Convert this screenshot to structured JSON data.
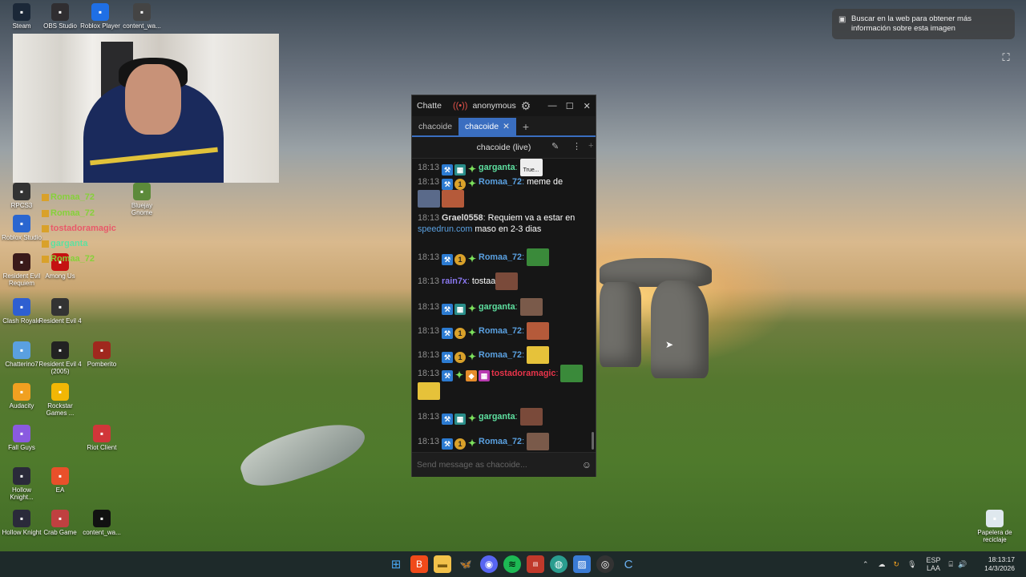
{
  "desktop_icons": [
    {
      "label": "Steam",
      "icon": "steam-icon",
      "color": "#1b2838"
    },
    {
      "label": "OBS Studio",
      "icon": "obs-icon",
      "color": "#302e31"
    },
    {
      "label": "Roblox Player",
      "icon": "roblox-icon",
      "color": "#1f6fe5"
    },
    {
      "label": "content_wa...",
      "icon": "file-icon",
      "color": "#444444"
    },
    {
      "label": "Clash Royale",
      "icon": "clash-royale-icon",
      "color": "#2e5fd1"
    },
    {
      "label": "Resident Evil 4",
      "icon": "resident-evil-icon",
      "color": "#333333"
    },
    {
      "label": "Chatterino7",
      "icon": "chatterino-icon",
      "color": "#5aa0e0"
    },
    {
      "label": "Resident Evil 4 (2005)",
      "icon": "resident-evil-2005-icon",
      "color": "#222222"
    },
    {
      "label": "Pomberito",
      "icon": "pomberito-icon",
      "color": "#a0281e"
    },
    {
      "label": "Audacity",
      "icon": "audacity-icon",
      "color": "#f0a020"
    },
    {
      "label": "Rockstar Games ...",
      "icon": "rockstar-icon",
      "color": "#f2b705"
    },
    {
      "label": "Fall Guys",
      "icon": "fall-guys-icon",
      "color": "#8a5ae0"
    },
    {
      "label": "Riot Client",
      "icon": "riot-icon",
      "color": "#d13639"
    },
    {
      "label": "Hollow Knight...",
      "icon": "hollow-knight-icon",
      "color": "#2a2a3a"
    },
    {
      "label": "EA",
      "icon": "ea-icon",
      "color": "#e8502a"
    },
    {
      "label": "Hollow Knight",
      "icon": "hollow-knight-icon",
      "color": "#2a2a3a"
    },
    {
      "label": "Crab Game",
      "icon": "crab-game-icon",
      "color": "#c04040"
    },
    {
      "label": "content_wa...",
      "icon": "file-icon",
      "color": "#111111"
    },
    {
      "label": "Roblox Studio",
      "icon": "roblox-studio-icon",
      "color": "#2a66d0"
    },
    {
      "label": "Resident Evil Requiem",
      "icon": "resident-evil-requiem-icon",
      "color": "#3a1a1a"
    },
    {
      "label": "Among Us",
      "icon": "among-us-icon",
      "color": "#c51111"
    },
    {
      "label": "RPCS3",
      "icon": "rpcs3-icon",
      "color": "#333333"
    },
    {
      "label": "Bluejay Gnome",
      "icon": "game-icon",
      "color": "#5c8a3a"
    },
    {
      "label": "Papelera de reciclaje",
      "icon": "recycle-bin-icon",
      "color": "#dfe8ee"
    }
  ],
  "overlay_chat": [
    {
      "name": "Romaa_72",
      "color": "#86d13a"
    },
    {
      "name": "Romaa_72",
      "color": "#86d13a"
    },
    {
      "name": "tostadoramagic",
      "color": "#e85a6a"
    },
    {
      "name": "garganta",
      "color": "#5ee0a0"
    },
    {
      "name": "Romaa_72",
      "color": "#86d13a"
    }
  ],
  "lens_popup": {
    "text": "Buscar en la web para obtener más información sobre esta imagen"
  },
  "chat_window": {
    "app_title": "Chatte",
    "user": "anonymous",
    "tabs": [
      {
        "label": "chacoide",
        "active": false
      },
      {
        "label": "chacoide",
        "active": true
      }
    ],
    "split_title": "chacoide (live)",
    "input_placeholder": "Send message as chacoide..."
  },
  "messages": [
    {
      "time": "18:13",
      "badges": [
        "mod",
        "gift",
        "star"
      ],
      "user": "garganta",
      "user_color": "#5ee0a0",
      "text": "",
      "emote": "True..."
    },
    {
      "time": "18:13",
      "badges": [
        "mod",
        "sub",
        "star"
      ],
      "user": "Romaa_72",
      "user_color": "#5aa0e0",
      "text": "meme de",
      "emote": ""
    },
    {
      "time": "18:13",
      "badges": [],
      "user": "Grael0558",
      "user_color": "#dddddd",
      "text": "Requiem va a estar en",
      "link": "speedrun.com",
      "text2": "maso en 2-3 dias"
    },
    {
      "time": "18:13",
      "badges": [
        "mod",
        "sub",
        "star"
      ],
      "user": "Romaa_72",
      "user_color": "#5aa0e0",
      "text": ""
    },
    {
      "time": "18:13",
      "badges": [],
      "user": "rain7x",
      "user_color": "#8a78f0",
      "text": "tostaa"
    },
    {
      "time": "18:13",
      "badges": [
        "mod",
        "gift",
        "star"
      ],
      "user": "garganta",
      "user_color": "#5ee0a0",
      "text": ""
    },
    {
      "time": "18:13",
      "badges": [
        "mod",
        "sub",
        "star"
      ],
      "user": "Romaa_72",
      "user_color": "#5aa0e0",
      "text": ""
    },
    {
      "time": "18:13",
      "badges": [
        "mod",
        "sub",
        "star"
      ],
      "user": "Romaa_72",
      "user_color": "#5aa0e0",
      "text": ""
    },
    {
      "time": "18:13",
      "badges": [
        "mod",
        "star",
        "box",
        "pink"
      ],
      "user": "tostadoramagic",
      "user_color": "#e8344a",
      "text": ""
    },
    {
      "time": "18:13",
      "badges": [
        "mod",
        "gift",
        "star"
      ],
      "user": "garganta",
      "user_color": "#5ee0a0",
      "text": ""
    },
    {
      "time": "18:13",
      "badges": [
        "mod",
        "sub",
        "star"
      ],
      "user": "Romaa_72",
      "user_color": "#5aa0e0",
      "text": ""
    }
  ],
  "taskbar": {
    "language": "ESP",
    "language_sub": "LAA",
    "time": "18:13:17",
    "date": "14/3/2026"
  }
}
